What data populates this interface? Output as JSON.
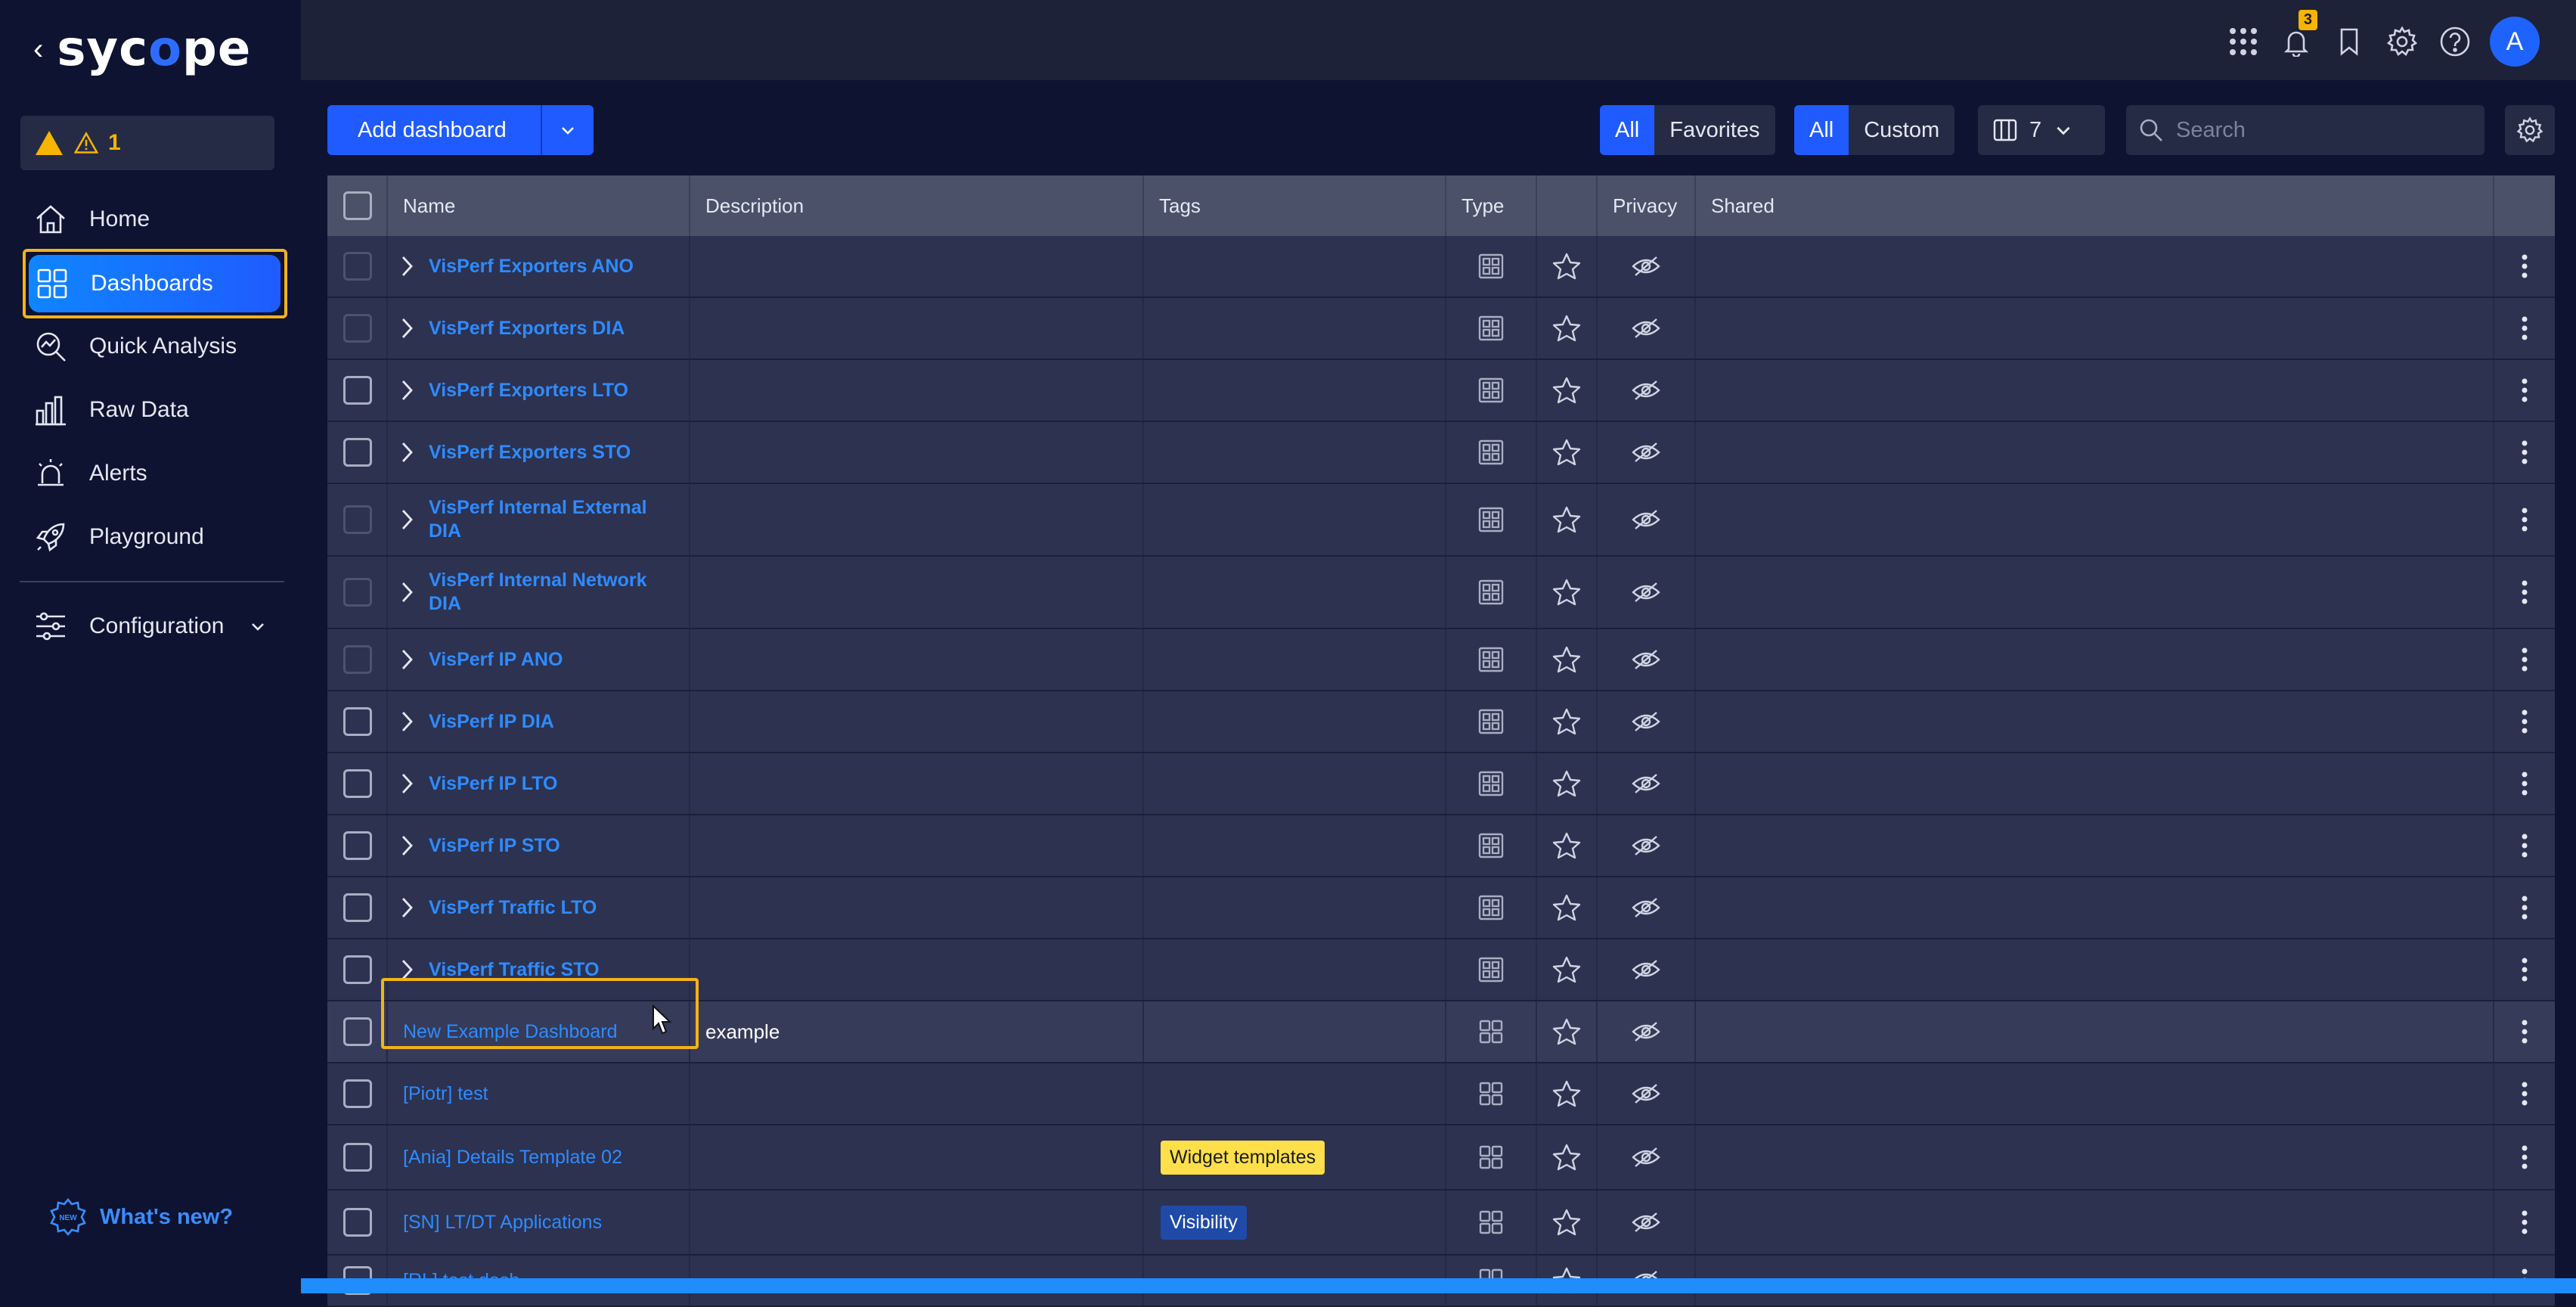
{
  "app": {
    "logo": "sycope",
    "logo_highlight": "o"
  },
  "sidebar": {
    "alert_count": "1",
    "items": [
      {
        "id": "home",
        "label": "Home",
        "icon": "home-icon"
      },
      {
        "id": "dashboards",
        "label": "Dashboards",
        "icon": "dashboards-icon",
        "active": true
      },
      {
        "id": "quick-analysis",
        "label": "Quick Analysis",
        "icon": "quick-analysis-icon"
      },
      {
        "id": "raw-data",
        "label": "Raw Data",
        "icon": "raw-data-icon"
      },
      {
        "id": "alerts",
        "label": "Alerts",
        "icon": "alarm-icon"
      },
      {
        "id": "playground",
        "label": "Playground",
        "icon": "rocket-icon"
      },
      {
        "id": "configuration",
        "label": "Configuration",
        "icon": "sliders-icon"
      }
    ],
    "whats_new": "What's new?"
  },
  "header": {
    "notification_badge": "3",
    "avatar_initial": "A"
  },
  "toolbar": {
    "add_label": "Add dashboard",
    "filter_a": [
      "All",
      "Favorites"
    ],
    "filter_b": [
      "All",
      "Custom"
    ],
    "columns_count": "7",
    "search_placeholder": "Search"
  },
  "table": {
    "columns": [
      "Name",
      "Description",
      "Tags",
      "Type",
      "",
      "Privacy",
      "Shared"
    ],
    "rows": [
      {
        "name": "VisPerf Exporters ANO",
        "group": true,
        "dim": true
      },
      {
        "name": "VisPerf Exporters DIA",
        "group": true,
        "dim": true
      },
      {
        "name": "VisPerf Exporters LTO",
        "group": true
      },
      {
        "name": "VisPerf Exporters STO",
        "group": true
      },
      {
        "name": "VisPerf Internal External DIA",
        "group": true,
        "dim": true,
        "tall": true
      },
      {
        "name": "VisPerf Internal Network DIA",
        "group": true,
        "dim": true,
        "tall": true
      },
      {
        "name": "VisPerf IP ANO",
        "group": true,
        "dim": true
      },
      {
        "name": "VisPerf IP DIA",
        "group": true
      },
      {
        "name": "VisPerf IP LTO",
        "group": true
      },
      {
        "name": "VisPerf IP STO",
        "group": true
      },
      {
        "name": "VisPerf Traffic LTO",
        "group": true
      },
      {
        "name": "VisPerf Traffic STO",
        "group": true
      },
      {
        "name": "New Example Dashboard",
        "description": "example",
        "highlight": true
      },
      {
        "name": "[Piotr] test"
      },
      {
        "name": "[Ania] Details Template 02",
        "tag": "Widget templates",
        "tag_color": "#ffe04a"
      },
      {
        "name": "[SN] LT/DT Applications",
        "tag": "Visibility",
        "tag_color": "#1f4aa8"
      },
      {
        "name": "[RL] test dash"
      }
    ]
  },
  "colors": {
    "accent": "#1f5bff",
    "highlight_outline": "#f2b21b",
    "link": "#2f8bff"
  }
}
